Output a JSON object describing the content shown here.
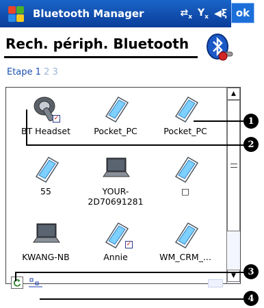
{
  "titlebar": {
    "app_title": "Bluetooth Manager",
    "ok_label": "ok",
    "icons": [
      "windows-start-icon",
      "connectivity-icon",
      "signal-icon",
      "volume-icon"
    ]
  },
  "header": {
    "title": "Rech. périph. Bluetooth",
    "logo_icon": "bluetooth-logo-icon"
  },
  "steps": {
    "label": "Etape",
    "current": "1",
    "others": [
      "2",
      "3"
    ]
  },
  "devices": [
    {
      "label": "BT Headset",
      "icon": "headset-icon",
      "checked": true
    },
    {
      "label": "Pocket_PC",
      "icon": "pda-icon",
      "checked": false
    },
    {
      "label": "Pocket_PC",
      "icon": "pda-icon",
      "checked": false
    },
    {
      "label": "55",
      "icon": "pda-icon",
      "checked": false
    },
    {
      "label": "YOUR-\n2D70691281",
      "icon": "laptop-icon",
      "checked": false
    },
    {
      "label": "□",
      "icon": "pda-icon",
      "checked": false
    },
    {
      "label": "KWANG-NB",
      "icon": "laptop-icon",
      "checked": false
    },
    {
      "label": "Annie",
      "icon": "pda-icon",
      "checked": true
    },
    {
      "label": "WM_CRM_...",
      "icon": "pda-icon",
      "checked": false
    }
  ],
  "callouts": [
    "1",
    "2",
    "3",
    "4"
  ],
  "bottombar": {
    "refresh_icon": "refresh-icon",
    "view_icon": "view-mode-icon",
    "keyboard_icon": "keyboard-icon"
  }
}
